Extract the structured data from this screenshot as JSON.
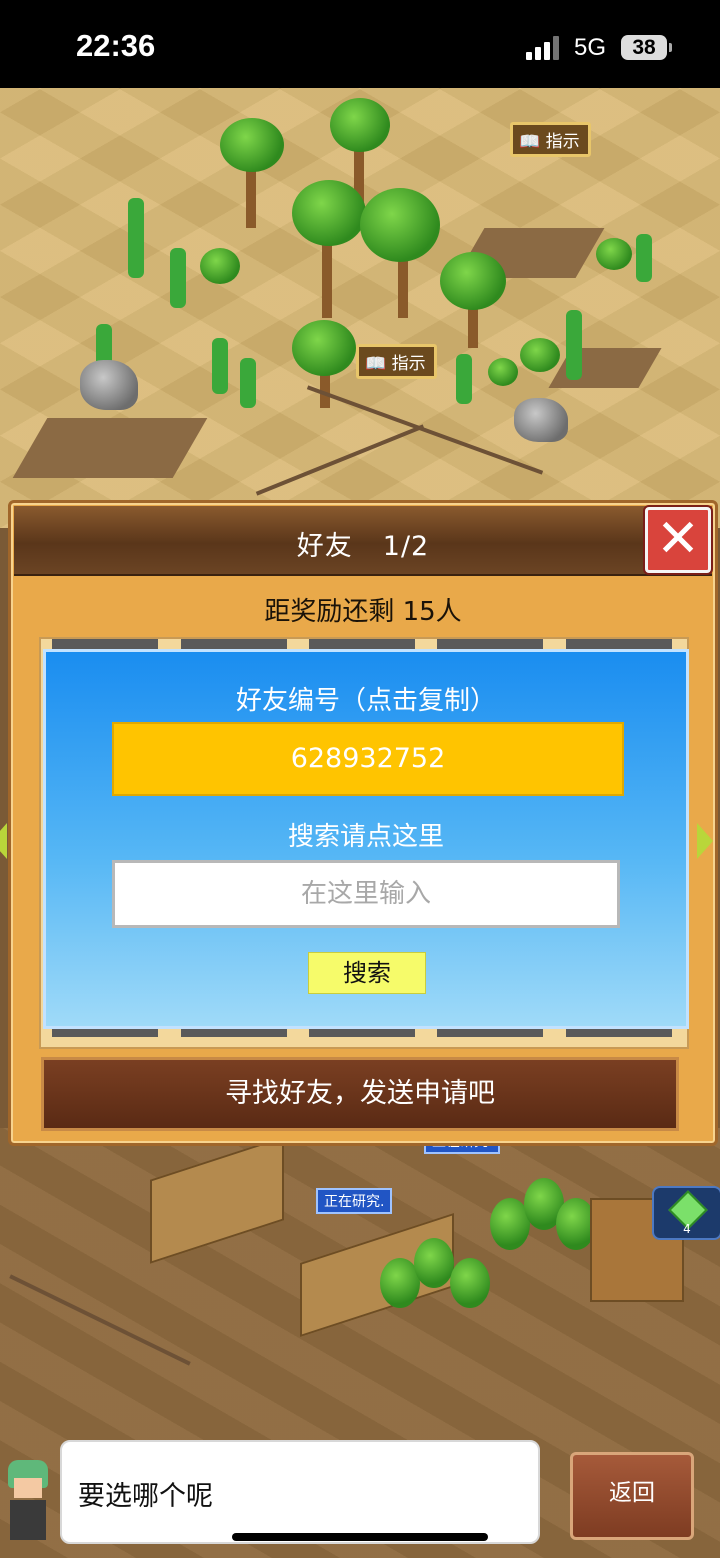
{
  "status_bar": {
    "time": "22:36",
    "network": "5G",
    "battery": "38"
  },
  "scene": {
    "signs": [
      "指示",
      "指示"
    ],
    "research_tags": [
      "正在研究.",
      "正在研究."
    ],
    "gem_count": "4"
  },
  "friends_dialog": {
    "title": "好友",
    "page": "1/2",
    "close_label": "✕",
    "reward_text": "距奖励还剩 15人",
    "id_label": "好友编号（点击复制）",
    "id_value": "628932752",
    "search_label": "搜索请点这里",
    "search_placeholder": "在这里输入",
    "search_button": "搜索",
    "find_banner": "寻找好友，发送申请吧"
  },
  "bottom": {
    "prompt": "要选哪个呢",
    "back_button": "返回"
  },
  "colors": {
    "dialog_bg": "#e9a94a",
    "panel_blue": "#1a8df0",
    "id_field": "#ffc400",
    "search_button": "#f6fb6a",
    "close_red": "#d9443c"
  }
}
